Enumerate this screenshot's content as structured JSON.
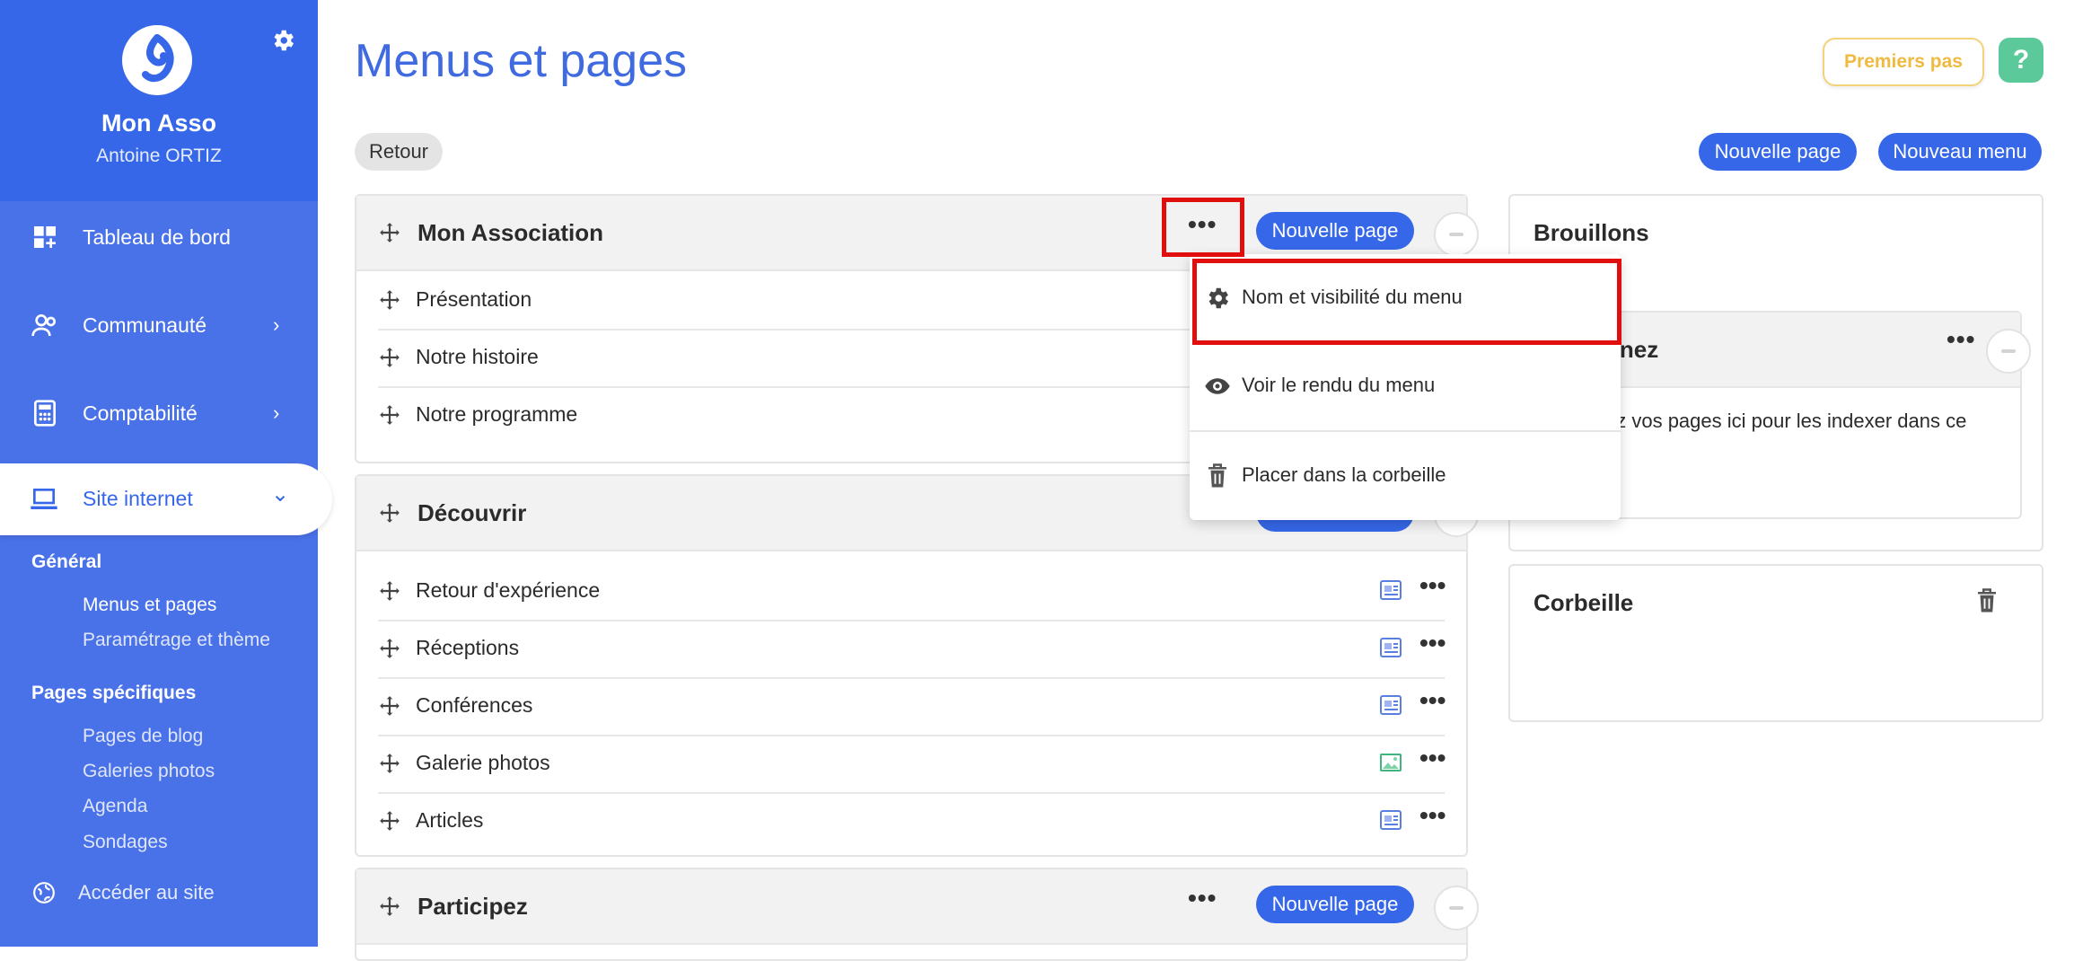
{
  "sidebar": {
    "org_name": "Mon Asso",
    "user_name": "Antoine ORTIZ",
    "nav": [
      {
        "label": "Tableau de bord",
        "icon": "dashboard-icon"
      },
      {
        "label": "Communauté",
        "icon": "community-icon",
        "chevron": "›"
      },
      {
        "label": "Comptabilité",
        "icon": "calculator-icon",
        "chevron": "›"
      },
      {
        "label": "Site internet",
        "icon": "laptop-icon",
        "chevron": "⌄"
      }
    ],
    "sections": [
      {
        "title": "Général",
        "items": [
          "Menus et pages",
          "Paramétrage et thème"
        ]
      },
      {
        "title": "Pages spécifiques",
        "items": [
          "Pages de blog",
          "Galeries photos",
          "Agenda",
          "Sondages"
        ]
      }
    ],
    "site_link": "Accéder au site"
  },
  "header": {
    "title": "Menus et pages",
    "premiers_pas": "Premiers pas",
    "help": "?"
  },
  "toolbar": {
    "back": "Retour",
    "new_page": "Nouvelle page",
    "new_menu": "Nouveau menu"
  },
  "menus": [
    {
      "title": "Mon Association",
      "new_page": "Nouvelle page",
      "pages": [
        {
          "label": "Présentation"
        },
        {
          "label": "Notre histoire"
        },
        {
          "label": "Notre programme"
        }
      ]
    },
    {
      "title": "Découvrir",
      "pages": [
        {
          "label": "Retour d'expérience",
          "type": "page"
        },
        {
          "label": "Réceptions",
          "type": "page"
        },
        {
          "label": "Conférences",
          "type": "page"
        },
        {
          "label": "Galerie photos",
          "type": "gallery"
        },
        {
          "label": "Articles",
          "type": "page"
        }
      ]
    },
    {
      "title": "Participez",
      "new_page": "Nouvelle page"
    }
  ],
  "dropdown": {
    "items": [
      {
        "label": "Nom et visibilité du menu",
        "icon": "gear-icon"
      },
      {
        "label": "Voir le rendu du menu",
        "icon": "eye-icon"
      },
      {
        "label": "Placer dans la corbeille",
        "icon": "trash-icon"
      }
    ]
  },
  "drafts": {
    "title": "Brouillons",
    "sub_title_fragment": "nnez",
    "sub_text_fragment": "ez vos pages ici pour les indexer dans ce"
  },
  "trash": {
    "title": "Corbeille"
  },
  "colors": {
    "sidebar": "#4a72e8",
    "sidebar_top": "#3567e8",
    "accent": "#3567e8",
    "highlight": "#e10e0e",
    "premiers_pas": "#f0b940",
    "help": "#5cc99a"
  }
}
